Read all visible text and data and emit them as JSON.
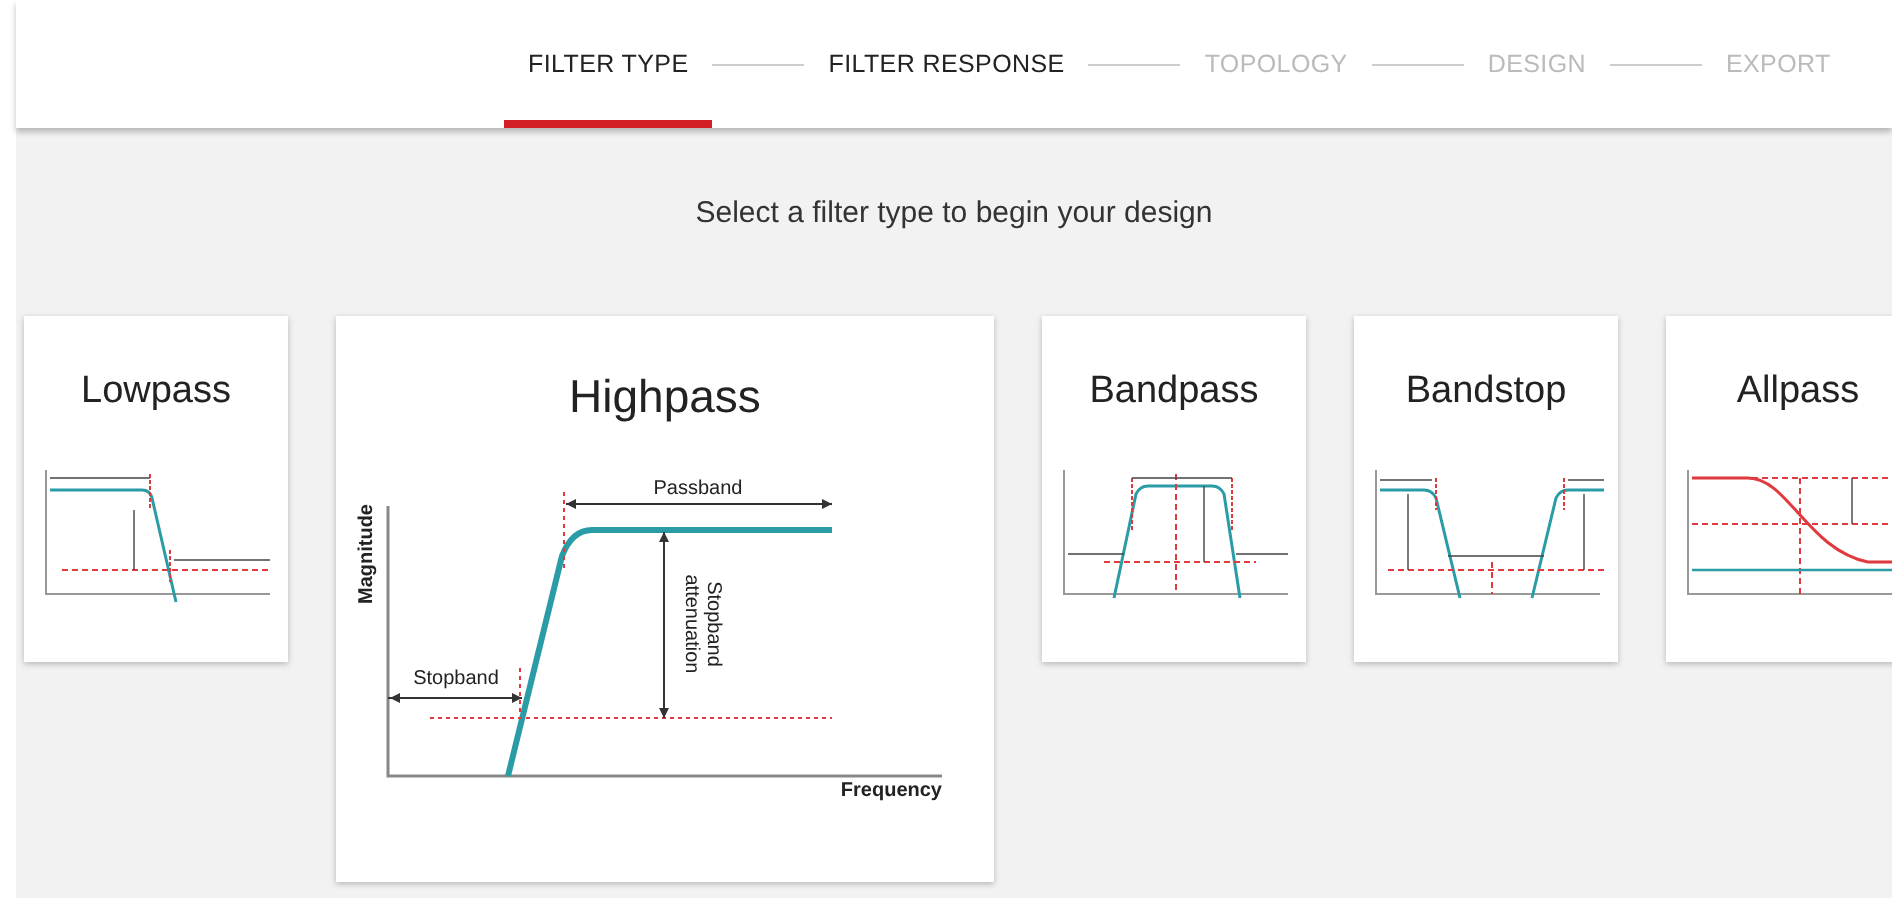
{
  "steps": [
    {
      "label": "FILTER TYPE",
      "selected": true,
      "disabled": false
    },
    {
      "label": "FILTER RESPONSE",
      "selected": false,
      "disabled": false
    },
    {
      "label": "TOPOLOGY",
      "selected": false,
      "disabled": true
    },
    {
      "label": "DESIGN",
      "selected": false,
      "disabled": true
    },
    {
      "label": "EXPORT",
      "selected": false,
      "disabled": true
    }
  ],
  "prompt": "Select a filter type to begin your design",
  "filters": [
    {
      "title": "Lowpass",
      "kind": "lowpass",
      "selected": false
    },
    {
      "title": "Highpass",
      "kind": "highpass",
      "selected": true,
      "diagram": {
        "ylabel": "Magnitude",
        "xlabel": "Frequency",
        "passband": "Passband",
        "stopband": "Stopband",
        "attenuation": [
          "Stopband",
          "attenuation"
        ]
      }
    },
    {
      "title": "Bandpass",
      "kind": "bandpass",
      "selected": false
    },
    {
      "title": "Bandstop",
      "kind": "bandstop",
      "selected": false
    },
    {
      "title": "Allpass",
      "kind": "allpass",
      "selected": false
    }
  ]
}
